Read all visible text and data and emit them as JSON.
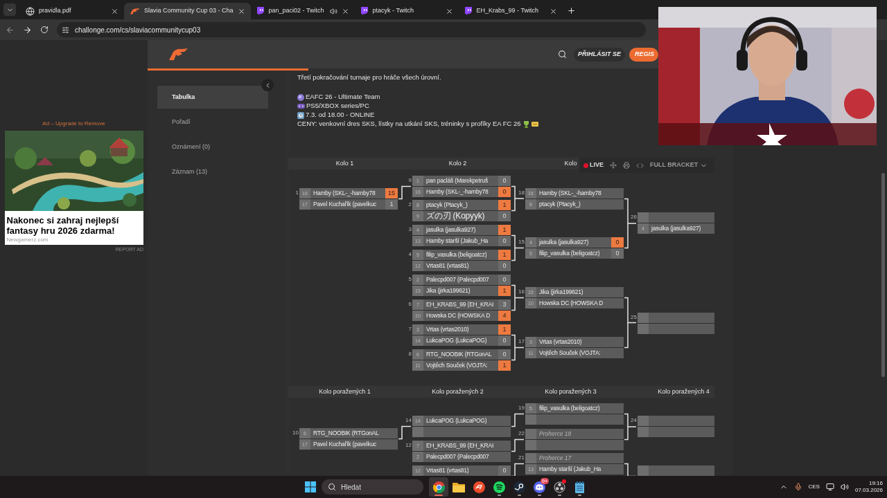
{
  "browser": {
    "tabs": [
      {
        "kind": "globe",
        "title": "pravidla.pdf",
        "selected": false,
        "audio": false
      },
      {
        "kind": "site",
        "title": "Slavia Community Cup 03 - Cha",
        "selected": true,
        "audio": false
      },
      {
        "kind": "stream",
        "title": "pan_paci02 - Twitch",
        "selected": false,
        "audio": true
      },
      {
        "kind": "stream",
        "title": "ptacyk - Twitch",
        "selected": false,
        "audio": false
      },
      {
        "kind": "stream",
        "title": "EH_Krabs_99 - Twitch",
        "selected": false,
        "audio": false
      }
    ],
    "url": "challonge.com/cs/slaviacommunitycup03"
  },
  "ad": {
    "label": "Ad – Upgrade to Remove",
    "headline": "Nakonec si zahraj nejlepší fantasy hru 2026 zdarma!",
    "source": "Newgamerz.com",
    "report": "REPORT AD"
  },
  "header": {
    "login": "PŘIHLÁSIT SE",
    "register": "REGIS"
  },
  "nav": [
    {
      "label": "Tabulka",
      "selected": true
    },
    {
      "label": "Pořadí",
      "selected": false
    },
    {
      "label": "Oznámení (0)",
      "selected": false
    },
    {
      "label": "Záznam (13)",
      "selected": false
    }
  ],
  "description": [
    {
      "kind": "text",
      "text": "Třetí pokračování turnaje pro hráče všech úrovní."
    },
    {
      "kind": "blank"
    },
    {
      "kind": "ball",
      "text": "EAFC 26 - Ultimate Team"
    },
    {
      "kind": "gamepad",
      "text": "PS5/XBOX series/PC"
    },
    {
      "kind": "clock",
      "text": "7.3. od 18.00 - ONLINE"
    },
    {
      "kind": "prizes",
      "text": "CENY: venkovní dres SKS, lístky na utkání SKS, tréninky s profíky EA FC 26"
    }
  ],
  "toolbar": {
    "live": "LIVE",
    "full_bracket": "FULL BRACKET"
  },
  "winners": {
    "rounds": [
      {
        "title": "Kolo 1",
        "matches": [
          {
            "number": "1",
            "rows": [
              {
                "kind": "player",
                "seed": "16",
                "name": "Hamby (SKL-_-hamby78",
                "score": "15",
                "winner": true
              },
              {
                "kind": "player",
                "seed": "17",
                "name": "Pavel Kuchařík (pavelkuc",
                "score": "1",
                "winner": false
              }
            ]
          }
        ]
      },
      {
        "title": "Kolo 2",
        "matches": [
          {
            "number": "9",
            "rows": [
              {
                "kind": "player",
                "seed": "1",
                "name": "pan pacláš (Marekpetruš",
                "score": "0",
                "winner": false
              },
              {
                "kind": "player",
                "seed": "16",
                "name": "Hamby (SKL-_-hamby78",
                "score": "0",
                "winner": true
              }
            ]
          },
          {
            "number": "2",
            "rows": [
              {
                "kind": "player",
                "seed": "8",
                "name": "ptacyk (Ptacyk_)",
                "score": "1",
                "winner": true
              },
              {
                "kind": "player",
                "seed": "9",
                "name": "ズの刃 (Kopyyk)",
                "score": "0",
                "winner": false
              }
            ]
          },
          {
            "number": "3",
            "rows": [
              {
                "kind": "player",
                "seed": "4",
                "name": "jasulka (jasulka927)",
                "score": "1",
                "winner": true
              },
              {
                "kind": "player",
                "seed": "13",
                "name": "Hamby starší (Jakub_Ha",
                "score": "0",
                "winner": false
              }
            ]
          },
          {
            "number": "4",
            "rows": [
              {
                "kind": "player",
                "seed": "5",
                "name": "filip_vasulka (beligoatcz)",
                "score": "1",
                "winner": true
              },
              {
                "kind": "player",
                "seed": "12",
                "name": "Vrtas81 (vrtas81)",
                "score": "0",
                "winner": false
              }
            ]
          },
          {
            "number": "5",
            "rows": [
              {
                "kind": "player",
                "seed": "2",
                "name": "Palecpd007 (Palecpd007",
                "score": "0",
                "winner": false
              },
              {
                "kind": "player",
                "seed": "15",
                "name": "Jika (jirka199621)",
                "score": "1",
                "winner": true
              }
            ]
          },
          {
            "number": "6",
            "rows": [
              {
                "kind": "player",
                "seed": "7",
                "name": "EH_KRABS_99 (EH_KRAI",
                "score": "3",
                "winner": false
              },
              {
                "kind": "player",
                "seed": "10",
                "name": "Howska DC (HOWSKA D",
                "score": "4",
                "winner": true
              }
            ]
          },
          {
            "number": "7",
            "rows": [
              {
                "kind": "player",
                "seed": "3",
                "name": "Vrtas (vrtas2010)",
                "score": "1",
                "winner": true
              },
              {
                "kind": "player",
                "seed": "14",
                "name": "LukcaPOG (LukcaPOG)",
                "score": "0",
                "winner": false
              }
            ]
          },
          {
            "number": "8",
            "rows": [
              {
                "kind": "player",
                "seed": "6",
                "name": "RTG_NOOBIK (RTGonAL",
                "score": "0",
                "winner": false
              },
              {
                "kind": "player",
                "seed": "11",
                "name": "Vojtěch Souček (VOJTA:",
                "score": "1",
                "winner": true
              }
            ]
          }
        ]
      },
      {
        "title": "Kolo",
        "matches": [
          {
            "number": "18",
            "rows": [
              {
                "kind": "player",
                "seed": "16",
                "name": "Hamby (SKL-_-hamby78"
              },
              {
                "kind": "player",
                "seed": "8",
                "name": "ptacyk (Ptacyk_)"
              }
            ]
          },
          {
            "number": "15",
            "rows": [
              {
                "kind": "player",
                "seed": "4",
                "name": "jasulka (jasulka927)",
                "score": "0",
                "winner": true
              },
              {
                "kind": "player",
                "seed": "5",
                "name": "filip_vasulka (beligoatcz)",
                "score": "0",
                "winner": false
              }
            ]
          },
          {
            "number": "16",
            "rows": [
              {
                "kind": "player",
                "seed": "15",
                "name": "Jika (jirka199621)"
              },
              {
                "kind": "player",
                "seed": "10",
                "name": "Howska DC (HOWSKA D"
              }
            ]
          },
          {
            "number": "17",
            "rows": [
              {
                "kind": "player",
                "seed": "3",
                "name": "Vrtas (vrtas2010)"
              },
              {
                "kind": "player",
                "seed": "11",
                "name": "Vojtěch Souček (VOJTA:"
              }
            ]
          }
        ]
      },
      {
        "matches": [
          {
            "number": "26",
            "rows": [
              {
                "kind": "empty"
              },
              {
                "kind": "player",
                "seed": "4",
                "name": "jasulka (jasulka927)"
              }
            ]
          },
          {
            "number": "25",
            "rows": [
              {
                "kind": "empty"
              },
              {
                "kind": "empty"
              }
            ]
          }
        ]
      }
    ]
  },
  "losers": {
    "rounds": [
      {
        "title": "Kolo poražených 1",
        "matches": [
          {
            "number": "10",
            "rows": [
              {
                "kind": "player",
                "seed": "6",
                "name": "RTG_NOOBIK (RTGonAL"
              },
              {
                "kind": "player",
                "seed": "17",
                "name": "Pavel Kuchařík (pavelkuc"
              }
            ]
          }
        ]
      },
      {
        "title": "Kolo poražených 2",
        "matches": [
          {
            "number": "14",
            "rows": [
              {
                "kind": "player",
                "seed": "14",
                "name": "LukcaPOG (LukcaPOG)"
              },
              {
                "kind": "empty"
              }
            ]
          },
          {
            "number": "12",
            "rows": [
              {
                "kind": "player",
                "seed": "7",
                "name": "EH_KRABS_99 (EH_KRAI"
              },
              {
                "kind": "player",
                "seed": "2",
                "name": "Palecpd007 (Palecpd007"
              }
            ]
          },
          {
            "rows": [
              {
                "kind": "player",
                "seed": "12",
                "name": "Vrtas81 (vrtas81)",
                "score": "0",
                "winner": false
              }
            ]
          }
        ]
      },
      {
        "title": "Kolo poražených 3",
        "matches": [
          {
            "number": "19",
            "rows": [
              {
                "kind": "player",
                "seed": "5",
                "name": "filip_vasulka (beligoatcz)"
              },
              {
                "kind": "empty"
              }
            ]
          },
          {
            "number": "22",
            "rows": [
              {
                "kind": "placeholder",
                "name": "Proherce 18"
              },
              {
                "kind": "empty"
              }
            ]
          },
          {
            "number": "21",
            "rows": [
              {
                "kind": "placeholder",
                "name": "Proherce 17"
              },
              {
                "kind": "player",
                "seed": "13",
                "name": "Hamby starší (Jakub_Ha"
              }
            ]
          }
        ]
      },
      {
        "title": "Kolo poražených 4",
        "matches": [
          {
            "number": "24",
            "rows": [
              {
                "kind": "empty"
              },
              {
                "kind": "empty"
              }
            ]
          },
          {
            "rows": [
              {
                "kind": "empty"
              }
            ]
          }
        ]
      }
    ]
  },
  "taskbar": {
    "search_placeholder": "Hledat",
    "apps": [
      {
        "kind": "browser",
        "active": true,
        "running": true,
        "alert": false
      },
      {
        "kind": "folder",
        "active": false,
        "running": false,
        "alert": false
      },
      {
        "kind": "ea",
        "active": false,
        "running": false,
        "alert": false
      },
      {
        "kind": "music",
        "active": false,
        "running": true,
        "alert": false
      },
      {
        "kind": "steam",
        "active": false,
        "running": true,
        "alert": false
      },
      {
        "kind": "chat",
        "active": false,
        "running": true,
        "alert": false,
        "badge": "9+"
      },
      {
        "kind": "recorder",
        "active": false,
        "running": true,
        "alert": true
      },
      {
        "kind": "notepad",
        "active": false,
        "running": true,
        "alert": false
      }
    ],
    "language": "CES",
    "time": "19:16",
    "date": "07.03.2026"
  }
}
